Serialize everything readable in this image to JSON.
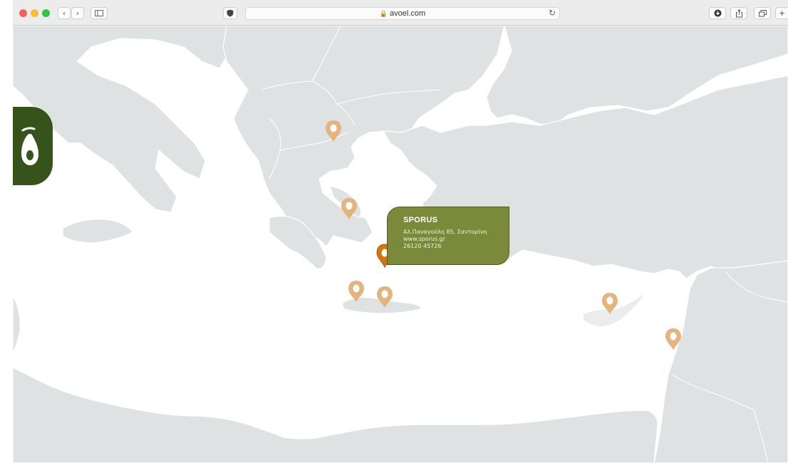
{
  "browser": {
    "url": "avoel.com"
  },
  "popup": {
    "title": "SPORUS",
    "address": "Αλ.Παναγούλη 85, Σαντορίνη",
    "website": "www.sporus.gr",
    "phone": "26120 45726"
  },
  "colors": {
    "land": "#dfe2e3",
    "sea": "#ffffff",
    "marker": "#e3b57c",
    "marker_active": "#d1780c",
    "popup_bg": "#7b8a3a",
    "logo_bg": "#36531b"
  }
}
